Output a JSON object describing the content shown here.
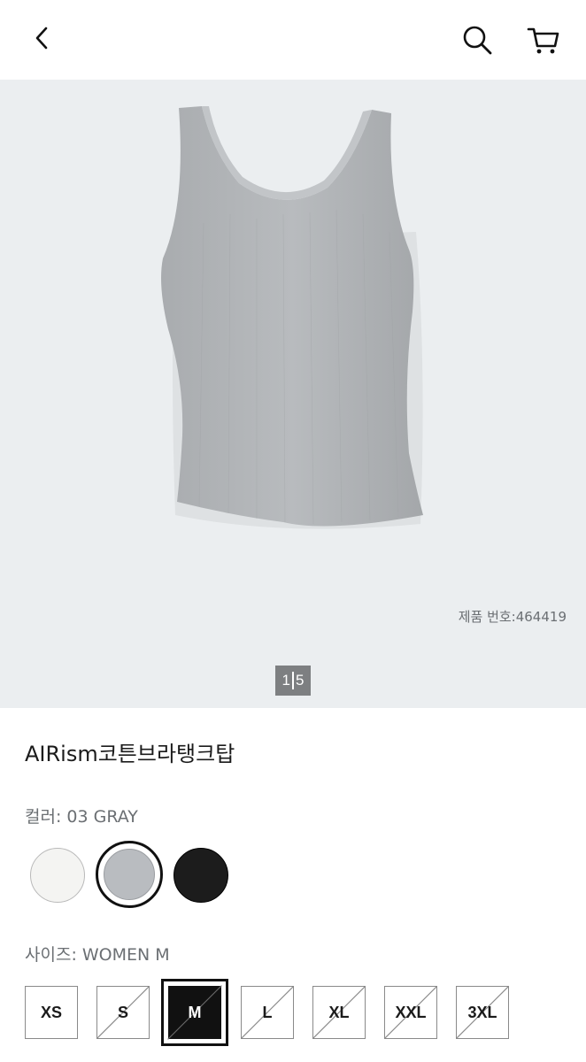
{
  "header": {
    "back_icon": "chevron-left-icon",
    "search_icon": "search-icon",
    "cart_icon": "cart-icon"
  },
  "gallery": {
    "product_id": "제품 번호:464419",
    "pager_current": "1",
    "pager_total": "5",
    "background_color": "#ebeef0"
  },
  "product": {
    "title": "AIRism코튼브라탱크탑",
    "color_label": "컬러: 03 GRAY",
    "size_label": "사이즈: WOMEN M"
  },
  "colors": [
    {
      "name": "white",
      "hex": "#f4f4f2",
      "selected": false
    },
    {
      "name": "gray",
      "hex": "#b9bcc0",
      "selected": true
    },
    {
      "name": "black",
      "hex": "#1c1c1c",
      "selected": false
    }
  ],
  "sizes": [
    {
      "label": "XS",
      "available": true,
      "selected": false
    },
    {
      "label": "S",
      "available": false,
      "selected": false
    },
    {
      "label": "M",
      "available": false,
      "selected": true
    },
    {
      "label": "L",
      "available": false,
      "selected": false
    },
    {
      "label": "XL",
      "available": false,
      "selected": false
    },
    {
      "label": "XXL",
      "available": false,
      "selected": false
    },
    {
      "label": "3XL",
      "available": false,
      "selected": false
    }
  ]
}
